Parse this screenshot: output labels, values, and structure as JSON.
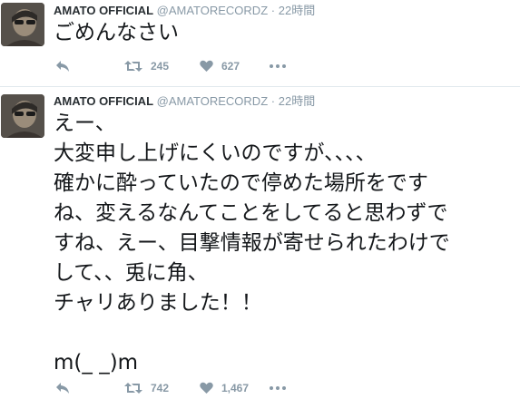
{
  "tweets": [
    {
      "name": "AMATO OFFICIAL",
      "handle": "@AMATORECORDZ",
      "dot": "·",
      "time": "22時間",
      "text": "ごめんなさい",
      "retweets": "245",
      "likes": "627"
    },
    {
      "name": "AMATO OFFICIAL",
      "handle": "@AMATORECORDZ",
      "dot": "·",
      "time": "22時間",
      "text": "えー、\n大変申し上げにくいのですが、、、、\n確かに酔っていたので停めた場所をです\nね、変えるなんてことをしてると思わずで\nすね、えー、目撃情報が寄せられたわけで\nして、、兎に角、\nチャリありました！！\n\nm(_ _)m",
      "retweets": "742",
      "likes": "1,467"
    }
  ],
  "icons": {
    "reply": "reply-icon",
    "retweet": "retweet-icon",
    "like": "heart-icon",
    "more": "more-icon"
  },
  "colors": {
    "icon_gray": "#8899a6",
    "divider": "#e1e8ed",
    "text": "#14171a"
  }
}
